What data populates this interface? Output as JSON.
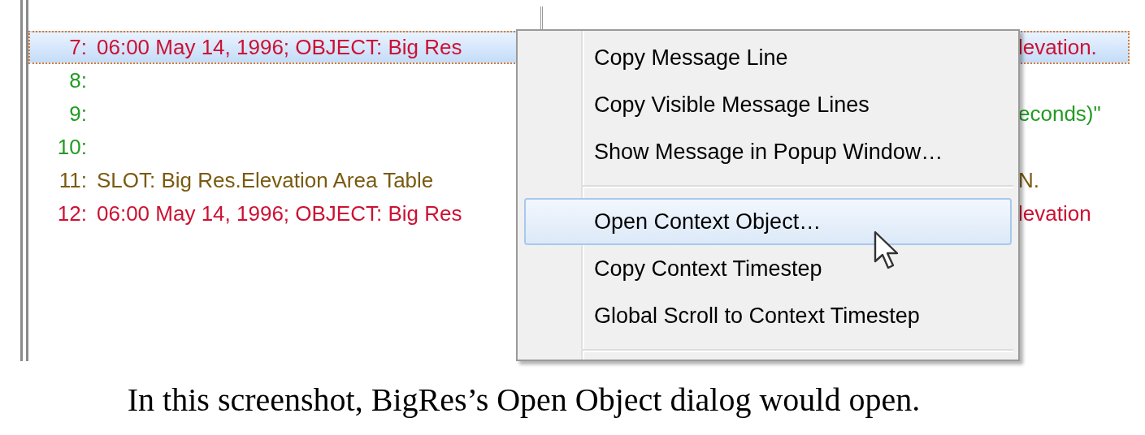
{
  "messages": [
    {
      "number": "7:",
      "text": "06:00 May 14, 1996; OBJECT: Big Res",
      "right_text": "levation.",
      "color": "#cc1133",
      "selected": true
    },
    {
      "number": "8:",
      "color": "#239a23",
      "selected": false
    },
    {
      "number": "9:",
      "right_text": "econds)\"",
      "color": "#239a23",
      "selected": false
    },
    {
      "number": "10:",
      "color": "#239a23",
      "selected": false
    },
    {
      "number": "11:",
      "text": "SLOT: Big Res.Elevation Area Table",
      "right_text": "N.",
      "color": "#7a5a10",
      "selected": false
    },
    {
      "number": "12:",
      "text": "06:00 May 14, 1996; OBJECT: Big Res",
      "right_text": "levation",
      "color": "#cc1133",
      "selected": false
    }
  ],
  "context_menu": [
    {
      "kind": "item",
      "label": "Copy Message Line",
      "selected": false
    },
    {
      "kind": "item",
      "label": "Copy Visible Message Lines",
      "selected": false
    },
    {
      "kind": "item",
      "label": "Show Message in Popup Window…",
      "selected": false
    },
    {
      "kind": "separator"
    },
    {
      "kind": "item",
      "label": "Open Context Object…",
      "selected": true
    },
    {
      "kind": "item",
      "label": "Copy Context Timestep",
      "selected": false
    },
    {
      "kind": "item",
      "label": "Global Scroll to Context Timestep",
      "selected": false
    },
    {
      "kind": "separator"
    }
  ],
  "caption": "In this screenshot, BigRes’s Open Object dialog would open."
}
